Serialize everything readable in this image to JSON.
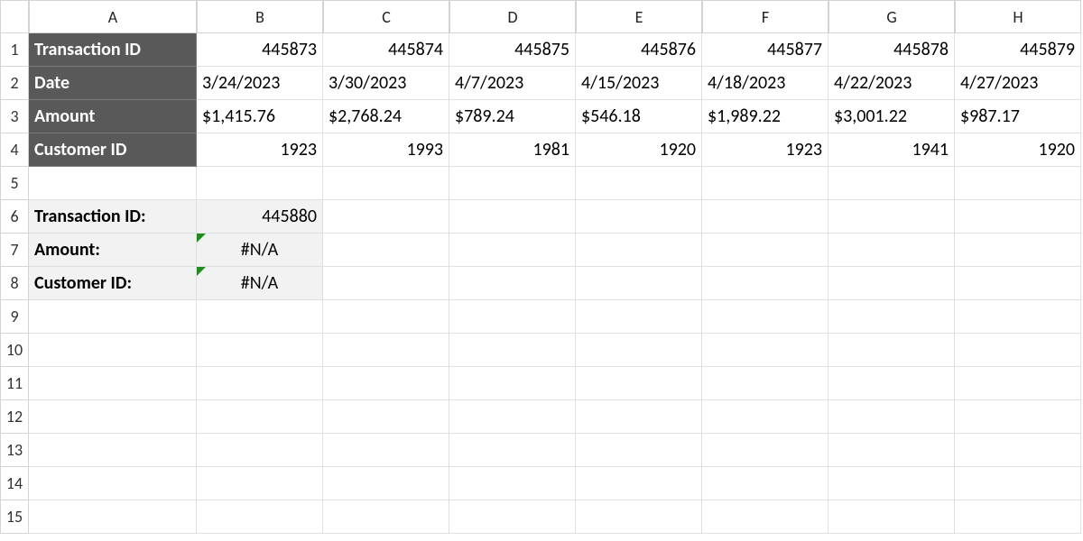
{
  "columns": [
    "A",
    "B",
    "C",
    "D",
    "E",
    "F",
    "G",
    "H"
  ],
  "rowCount": 15,
  "headerLabels": {
    "r1": "Transaction ID",
    "r2": "Date",
    "r3": "Amount",
    "r4": "Customer ID"
  },
  "data": {
    "transactionId": [
      "445873",
      "445874",
      "445875",
      "445876",
      "445877",
      "445878",
      "445879"
    ],
    "date": [
      "3/24/2023",
      "3/30/2023",
      "4/7/2023",
      "4/15/2023",
      "4/18/2023",
      "4/22/2023",
      "4/27/2023"
    ],
    "amount": [
      "$1,415.76",
      "$2,768.24",
      "$789.24",
      "$546.18",
      "$1,989.22",
      "$3,001.22",
      "$987.17"
    ],
    "customerId": [
      "1923",
      "1993",
      "1981",
      "1920",
      "1923",
      "1941",
      "1920"
    ]
  },
  "lookup": {
    "labelTransactionId": "Transaction ID:",
    "valueTransactionId": "445880",
    "labelAmount": "Amount:",
    "valueAmount": "#N/A",
    "labelCustomerId": "Customer ID:",
    "valueCustomerId": "#N/A"
  },
  "chart_data": {
    "type": "table",
    "title": "",
    "series": [
      {
        "name": "Transaction ID",
        "values": [
          445873,
          445874,
          445875,
          445876,
          445877,
          445878,
          445879
        ]
      },
      {
        "name": "Date",
        "values": [
          "3/24/2023",
          "3/30/2023",
          "4/7/2023",
          "4/15/2023",
          "4/18/2023",
          "4/22/2023",
          "4/27/2023"
        ]
      },
      {
        "name": "Amount",
        "values": [
          1415.76,
          2768.24,
          789.24,
          546.18,
          1989.22,
          3001.22,
          987.17
        ]
      },
      {
        "name": "Customer ID",
        "values": [
          1923,
          1993,
          1981,
          1920,
          1923,
          1941,
          1920
        ]
      }
    ],
    "lookup": {
      "Transaction ID": 445880,
      "Amount": "#N/A",
      "Customer ID": "#N/A"
    }
  }
}
